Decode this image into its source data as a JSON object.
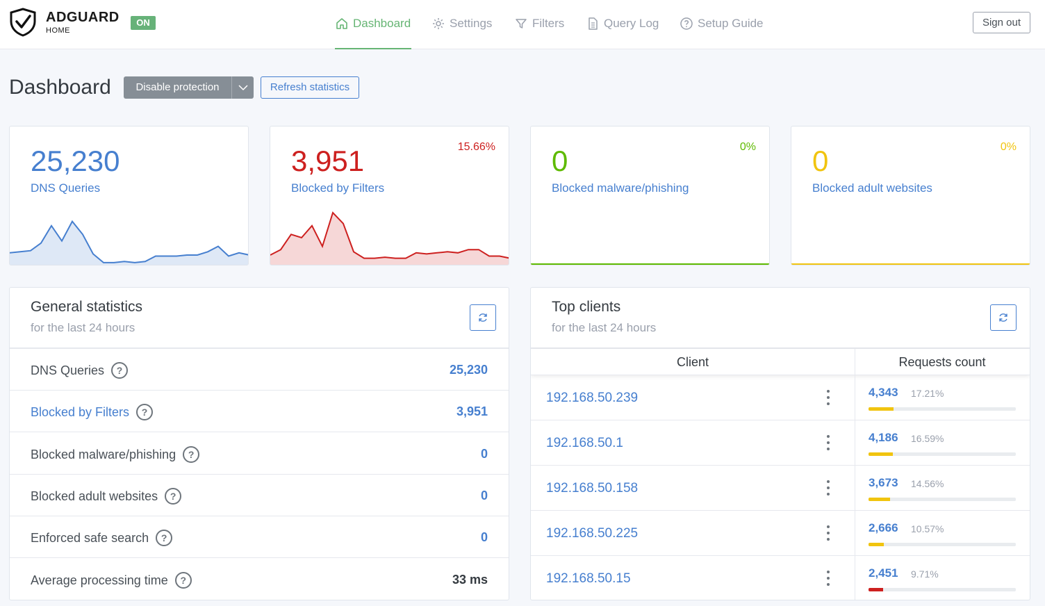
{
  "header": {
    "brand": "ADGUARD",
    "brand_sub": "HOME",
    "status_badge": "ON",
    "nav": [
      {
        "label": "Dashboard",
        "icon": "home-icon",
        "active": true
      },
      {
        "label": "Settings",
        "icon": "gear-icon",
        "active": false
      },
      {
        "label": "Filters",
        "icon": "filter-icon",
        "active": false
      },
      {
        "label": "Query Log",
        "icon": "document-icon",
        "active": false
      },
      {
        "label": "Setup Guide",
        "icon": "help-circle-icon",
        "active": false
      }
    ],
    "sign_out": "Sign out"
  },
  "page": {
    "title": "Dashboard",
    "disable_protection": "Disable protection",
    "refresh_statistics": "Refresh statistics"
  },
  "colors": {
    "blue": "#467fcf",
    "red": "#cd201f",
    "green": "#5eba00",
    "yellow": "#f1c40f",
    "accent_green": "#66b574"
  },
  "stats": [
    {
      "value": "25,230",
      "label": "DNS Queries",
      "percent": "",
      "color": "#467fcf"
    },
    {
      "value": "3,951",
      "label": "Blocked by Filters",
      "percent": "15.66%",
      "color": "#cd201f"
    },
    {
      "value": "0",
      "label": "Blocked malware/phishing",
      "percent": "0%",
      "color": "#5eba00"
    },
    {
      "value": "0",
      "label": "Blocked adult websites",
      "percent": "0%",
      "color": "#f1c40f"
    }
  ],
  "sparklines": {
    "dns_queries": [
      3,
      4,
      5,
      12,
      28,
      14,
      32,
      20,
      2,
      -6,
      -6,
      -5,
      -6,
      -5,
      0,
      0,
      0,
      1,
      1,
      4,
      9,
      0,
      3,
      1
    ],
    "blocked_by_filters": [
      1,
      6,
      20,
      17,
      28,
      9,
      40,
      30,
      4,
      -2,
      -2,
      -1,
      -2,
      -2,
      3,
      2,
      3,
      4,
      3,
      6,
      6,
      0,
      0,
      -2
    ]
  },
  "general": {
    "title": "General statistics",
    "subtitle": "for the last 24 hours",
    "rows": [
      {
        "label": "DNS Queries",
        "value": "25,230"
      },
      {
        "label": "Blocked by Filters",
        "value": "3,951"
      },
      {
        "label": "Blocked malware/phishing",
        "value": "0"
      },
      {
        "label": "Blocked adult websites",
        "value": "0"
      },
      {
        "label": "Enforced safe search",
        "value": "0"
      },
      {
        "label": "Average processing time",
        "value": "33 ms"
      }
    ]
  },
  "clients": {
    "title": "Top clients",
    "subtitle": "for the last 24 hours",
    "col_client": "Client",
    "col_requests": "Requests count",
    "rows": [
      {
        "ip": "192.168.50.239",
        "count": "4,343",
        "percent": "17.21%",
        "fraction": 0.1721,
        "bar_color": "#f1c40f"
      },
      {
        "ip": "192.168.50.1",
        "count": "4,186",
        "percent": "16.59%",
        "fraction": 0.1659,
        "bar_color": "#f1c40f"
      },
      {
        "ip": "192.168.50.158",
        "count": "3,673",
        "percent": "14.56%",
        "fraction": 0.1456,
        "bar_color": "#f1c40f"
      },
      {
        "ip": "192.168.50.225",
        "count": "2,666",
        "percent": "10.57%",
        "fraction": 0.1057,
        "bar_color": "#f1c40f"
      },
      {
        "ip": "192.168.50.15",
        "count": "2,451",
        "percent": "9.71%",
        "fraction": 0.0971,
        "bar_color": "#cd201f"
      }
    ]
  }
}
